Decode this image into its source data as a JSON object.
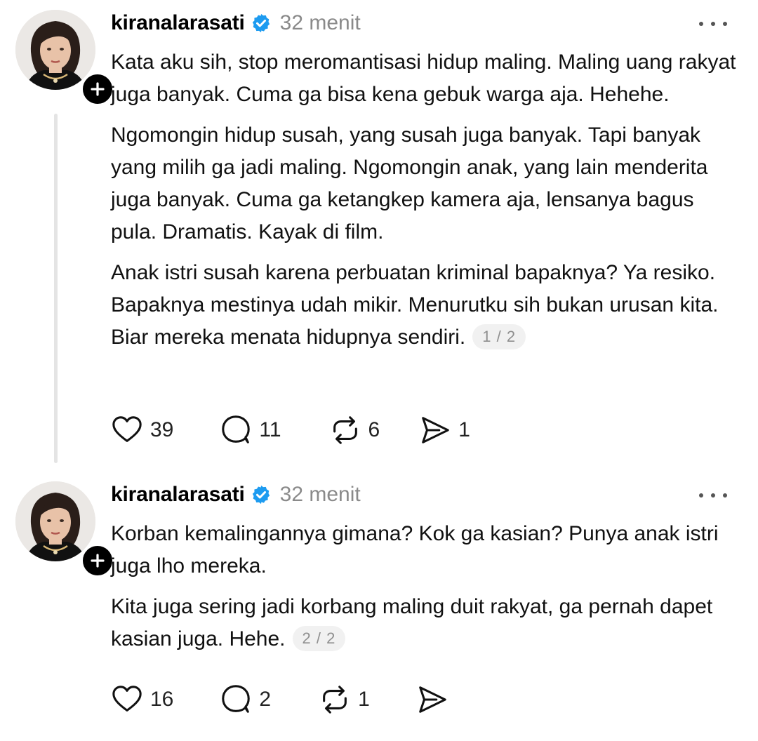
{
  "posts": [
    {
      "username": "kiranalarasati",
      "time": "32 menit",
      "paragraphs": [
        "Kata aku sih, stop meromantisasi hidup maling. Maling uang rakyat juga banyak. Cuma ga bisa kena gebuk warga aja. Hehehe.",
        "Ngomongin hidup susah, yang susah juga banyak. Tapi banyak yang milih ga jadi maling. Ngomongin anak, yang lain menderita juga banyak. Cuma ga ketangkep kamera aja, lensanya bagus pula. Dramatis. Kayak di film.",
        "Anak istri susah karena perbuatan kriminal bapaknya? Ya resiko. Bapaknya mestinya udah mikir. Menurutku sih bukan urusan kita. Biar mereka menata hidupnya sendiri."
      ],
      "counter": "1 / 2",
      "likes": "39",
      "replies": "11",
      "reposts": "6",
      "shares": "1"
    },
    {
      "username": "kiranalarasati",
      "time": "32 menit",
      "paragraphs": [
        "Korban kemalingannya gimana? Kok ga kasian? Punya anak istri juga lho mereka.",
        "Kita juga sering jadi korbang maling duit rakyat, ga pernah dapet kasian juga. Hehe."
      ],
      "counter": "2 / 2",
      "likes": "16",
      "replies": "2",
      "reposts": "1",
      "shares": ""
    }
  ],
  "icons": {
    "like": "heart-icon",
    "reply": "comment-icon",
    "repost": "repost-icon",
    "share": "send-icon",
    "verified": "verified-badge-icon",
    "more": "more-options-icon",
    "follow": "plus-icon"
  },
  "colors": {
    "verified": "#1d9bf0",
    "muted": "#8a8a8a",
    "thread_line": "#e4e4e4"
  }
}
